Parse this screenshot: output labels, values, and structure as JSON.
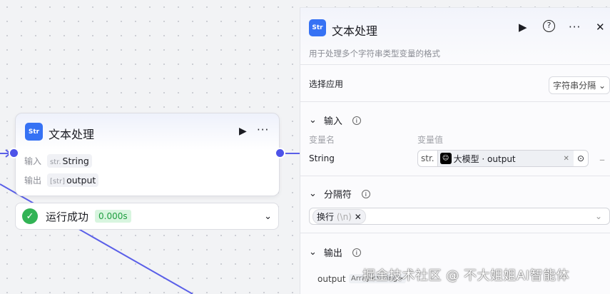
{
  "node": {
    "title": "文本处理",
    "icon": "Str",
    "input_label": "输入",
    "input_type": "str.",
    "input_value": "String",
    "output_label": "输出",
    "output_type": "[str]",
    "output_value": "output"
  },
  "status": {
    "text": "运行成功",
    "time": "0.000s"
  },
  "panel": {
    "title": "文本处理",
    "icon": "Str",
    "description": "用于处理多个字符串类型变量的格式",
    "select_label": "选择应用",
    "select_value": "字符串分隔",
    "input_section": "输入",
    "col_name": "变量名",
    "col_value": "变量值",
    "var_name": "String",
    "var_type": "str.",
    "var_ref": "大模型 · output",
    "separator_section": "分隔符",
    "separator_tag": "换行",
    "separator_hint": "(\\n)",
    "output_section": "输出",
    "output_name": "output",
    "output_type": "Array<String>"
  },
  "watermark": "掘金技术社区 @ 不大姐姐AI智能体"
}
